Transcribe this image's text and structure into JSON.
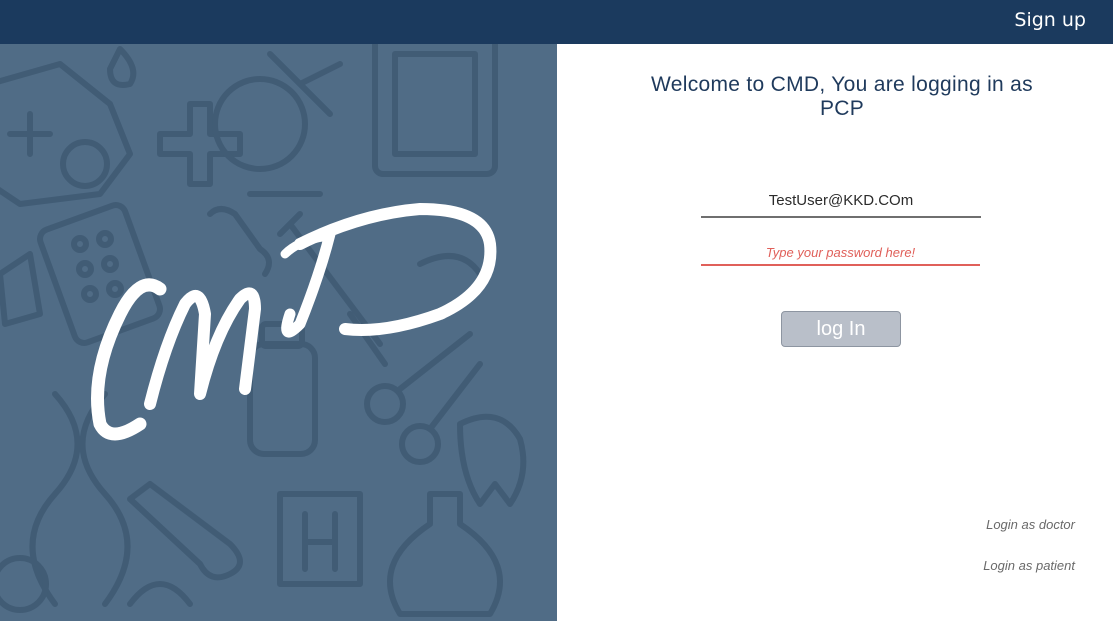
{
  "header": {
    "signup_label": "Sign up",
    "bar_color": "#1b3a5e"
  },
  "brand": {
    "logo_text": "CMD",
    "panel_color": "#506c86"
  },
  "login": {
    "welcome_line": "Welcome to CMD, You are logging in as PCP",
    "email_value": "TestUser@KKD.COm",
    "password_placeholder": "Type your password here!",
    "login_button_label": "log In",
    "login_as_doctor": "Login as doctor",
    "login_as_patient": "Login as patient",
    "error_color": "#e0605a"
  }
}
